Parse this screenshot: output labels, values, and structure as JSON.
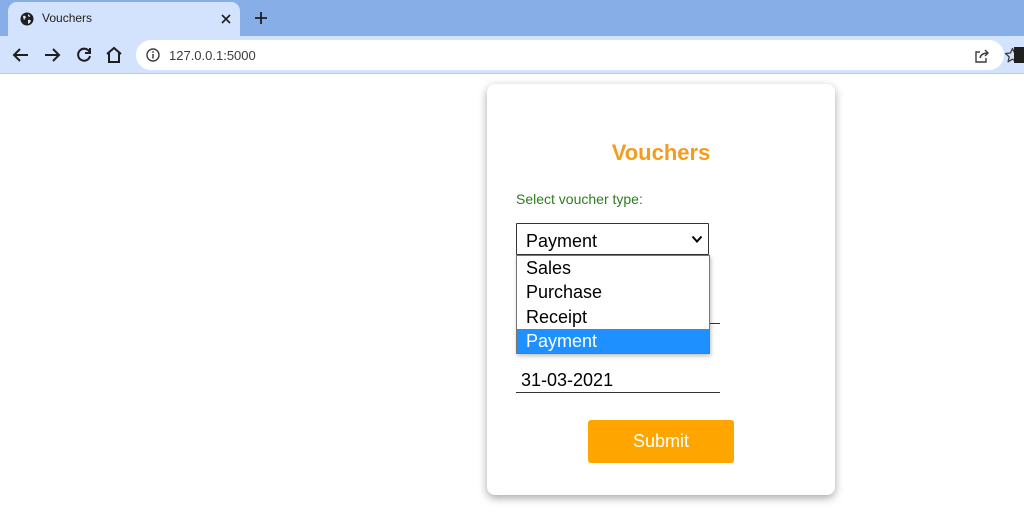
{
  "browser": {
    "tab_title": "Vouchers",
    "url": "127.0.0.1:5000"
  },
  "form": {
    "title": "Vouchers",
    "voucher_type_label": "Select voucher type:",
    "voucher_type_value": "Payment",
    "voucher_type_options": [
      "Sales",
      "Purchase",
      "Receipt",
      "Payment"
    ],
    "selected_option": "Payment",
    "date_value": "31-03-2021",
    "submit_label": "Submit"
  },
  "colors": {
    "title": "#f39c1e",
    "label": "#2e7d1e",
    "submit_bg": "#ffa500",
    "selected_option_bg": "#1e90ff"
  }
}
